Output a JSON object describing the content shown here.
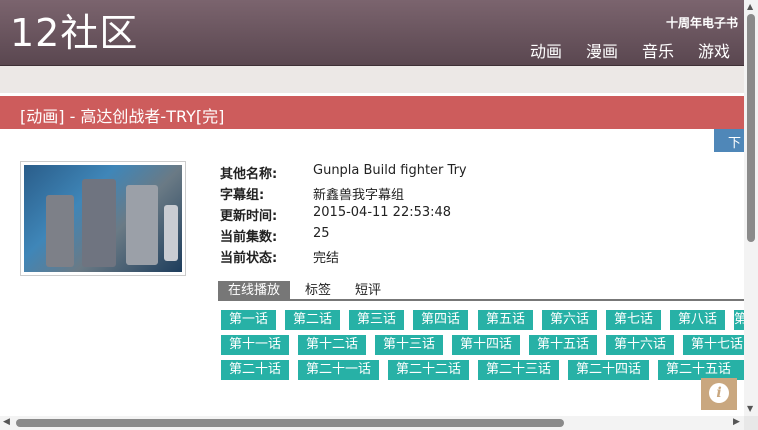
{
  "header": {
    "logo": "12社区",
    "tagline": "十周年电子书",
    "nav": [
      "动画",
      "漫画",
      "音乐",
      "游戏"
    ]
  },
  "title_bar": {
    "title": "[动画] - 高达创战者-TRY[完]"
  },
  "download_button": {
    "label": "下"
  },
  "info": {
    "rows": [
      {
        "label": "其他名称:",
        "value": "Gunpla Build fighter Try"
      },
      {
        "label": "字幕组:",
        "value": "新鑫兽我字幕组"
      },
      {
        "label": "更新时间:",
        "value": "2015-04-11 22:53:48"
      },
      {
        "label": "当前集数:",
        "value": "25"
      },
      {
        "label": "当前状态:",
        "value": "完结"
      }
    ]
  },
  "tabs": [
    "在线播放",
    "标签",
    "短评"
  ],
  "episodes": {
    "row1": [
      "第一话",
      "第二话",
      "第三话",
      "第四话",
      "第五话",
      "第六话",
      "第七话",
      "第八话",
      "第九话"
    ],
    "row2": [
      "第十一话",
      "第十二话",
      "第十三话",
      "第十四话",
      "第十五话",
      "第十六话",
      "第十七话"
    ],
    "row3": [
      "第二十话",
      "第二十一话",
      "第二十二话",
      "第二十三话",
      "第二十四话",
      "第二十五话"
    ]
  },
  "colors": {
    "header": "#6b5660",
    "title_bar": "#cd5c5c",
    "episode_button": "#27b1a6",
    "download_button": "#4f87b8",
    "info_button": "#c9a77f"
  },
  "info_button": {
    "icon": "info-icon"
  }
}
